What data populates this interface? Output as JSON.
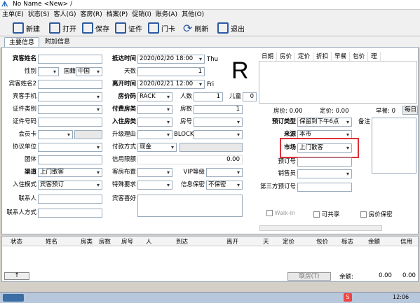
{
  "window": {
    "title": "No Name <New> /"
  },
  "menu": [
    "主单(E)",
    "状态(S)",
    "客人(G)",
    "客房(R)",
    "档案(P)",
    "促销(I)",
    "账务(A)",
    "其他(O)"
  ],
  "toolbar": {
    "new": "新建",
    "open": "打开",
    "save": "保存",
    "cert": "证件",
    "card": "门卡",
    "refresh": "刷新",
    "exit": "退出"
  },
  "tabs": {
    "main": "主要信息",
    "extra": "附加信息"
  },
  "col1": {
    "guest_name": "宾客姓名",
    "gender": "性别",
    "nationality": "国籍",
    "nationality_val": "中国",
    "guest_name2": "宾客姓名2",
    "mobile": "宾客手机",
    "id_type": "证件类别",
    "id_no": "证件号码",
    "member_card": "会员卡",
    "company": "协议单位",
    "group": "团体",
    "channel": "渠道",
    "channel_val": "上门散客",
    "checkin_mode": "入住模式",
    "checkin_mode_val": "宾客预订",
    "contact": "联系人",
    "contact_method": "联系人方式"
  },
  "col2": {
    "arrival": "抵达时间",
    "arrival_val": "2020/02/20 18:00",
    "arrival_day": "Thu",
    "nights": "天数",
    "nights_val": "1",
    "departure": "离开时间",
    "departure_val": "2020/02/21 12:00",
    "departure_day": "Fri",
    "rate_code": "房价码",
    "rate_code_val": "RACK",
    "adults": "人数",
    "adults_val": "1",
    "children": "儿童",
    "children_val": "0",
    "pay_type": "付费房类",
    "rooms": "房数",
    "rooms_val": "1",
    "room_type": "入住房类",
    "room_no": "房号",
    "upgrade": "升级理由",
    "block": "BLOCK",
    "payment": "付款方式",
    "payment_val": "现金",
    "credit_limit": "信用限额",
    "credit_val": "0.00",
    "room_layout": "客房布置",
    "vip": "VIP等级",
    "special": "特殊要求",
    "secret": "信息保密",
    "secret_val": "不保密",
    "pref": "宾客喜好"
  },
  "big_letter": "R",
  "rate_grid": {
    "headers": [
      "日期",
      "房价",
      "定价",
      "折扣",
      "早餐",
      "包价",
      "理"
    ],
    "room_rate": "房价: 0.00",
    "list_price": "定价: 0.00",
    "breakfast": "早餐: 0",
    "daily": "每日"
  },
  "col3": {
    "res_type": "预订类型",
    "res_type_val": "保留到下午6点",
    "remark": "备注",
    "source": "来源",
    "source_val": "本市",
    "market": "市场",
    "market_val": "上门散客",
    "res_no": "预订号",
    "sales": "销售员",
    "third_res": "第三方预订号",
    "walkin": "Walk-In",
    "shareable": "可共享",
    "rate_secret": "房价保密"
  },
  "bottom_grid": {
    "headers": [
      "状态",
      "姓名",
      "房类",
      "房数",
      "房号",
      "人",
      "到达",
      "离开",
      "天",
      "定价",
      "包价",
      "标志",
      "余额",
      "信用"
    ]
  },
  "footer": {
    "checkin": "联房(T)",
    "balance": "余额:",
    "balance_val": "0.00",
    "credit_val": "0.00"
  },
  "taskbar": {
    "time": "12:06"
  }
}
